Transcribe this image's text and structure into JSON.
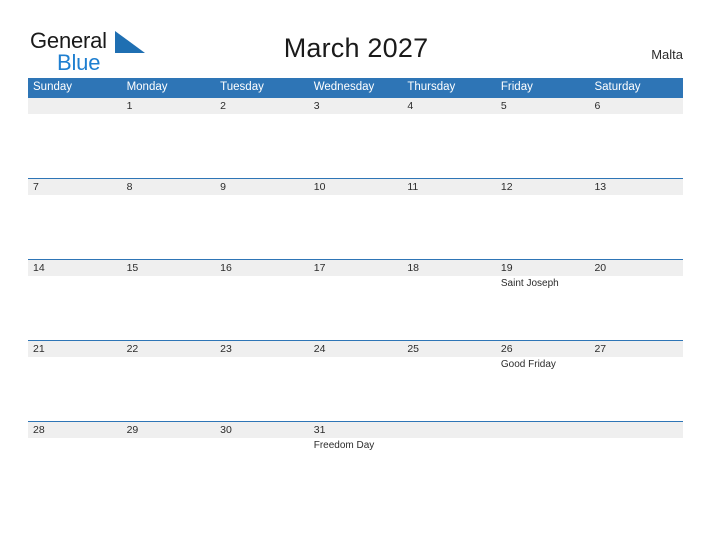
{
  "brand": {
    "name_part1": "General",
    "name_part2": "Blue",
    "flag_icon": "blue-triangle-flag-icon",
    "accent_color": "#1f7fd0"
  },
  "header": {
    "title": "March 2027",
    "country": "Malta"
  },
  "theme": {
    "header_blue": "#2e75b6",
    "row_band_gray": "#efefef",
    "divider_blue": "#2e75b6",
    "text_dark": "#2b2b2b"
  },
  "calendar": {
    "weekdays": [
      "Sunday",
      "Monday",
      "Tuesday",
      "Wednesday",
      "Thursday",
      "Friday",
      "Saturday"
    ],
    "weeks": [
      {
        "days": [
          {
            "date": "",
            "event": ""
          },
          {
            "date": "1",
            "event": ""
          },
          {
            "date": "2",
            "event": ""
          },
          {
            "date": "3",
            "event": ""
          },
          {
            "date": "4",
            "event": ""
          },
          {
            "date": "5",
            "event": ""
          },
          {
            "date": "6",
            "event": ""
          }
        ]
      },
      {
        "days": [
          {
            "date": "7",
            "event": ""
          },
          {
            "date": "8",
            "event": ""
          },
          {
            "date": "9",
            "event": ""
          },
          {
            "date": "10",
            "event": ""
          },
          {
            "date": "11",
            "event": ""
          },
          {
            "date": "12",
            "event": ""
          },
          {
            "date": "13",
            "event": ""
          }
        ]
      },
      {
        "days": [
          {
            "date": "14",
            "event": ""
          },
          {
            "date": "15",
            "event": ""
          },
          {
            "date": "16",
            "event": ""
          },
          {
            "date": "17",
            "event": ""
          },
          {
            "date": "18",
            "event": ""
          },
          {
            "date": "19",
            "event": "Saint Joseph"
          },
          {
            "date": "20",
            "event": ""
          }
        ]
      },
      {
        "days": [
          {
            "date": "21",
            "event": ""
          },
          {
            "date": "22",
            "event": ""
          },
          {
            "date": "23",
            "event": ""
          },
          {
            "date": "24",
            "event": ""
          },
          {
            "date": "25",
            "event": ""
          },
          {
            "date": "26",
            "event": "Good Friday"
          },
          {
            "date": "27",
            "event": ""
          }
        ]
      },
      {
        "days": [
          {
            "date": "28",
            "event": ""
          },
          {
            "date": "29",
            "event": ""
          },
          {
            "date": "30",
            "event": ""
          },
          {
            "date": "31",
            "event": "Freedom Day"
          },
          {
            "date": "",
            "event": ""
          },
          {
            "date": "",
            "event": ""
          },
          {
            "date": "",
            "event": ""
          }
        ]
      }
    ]
  }
}
